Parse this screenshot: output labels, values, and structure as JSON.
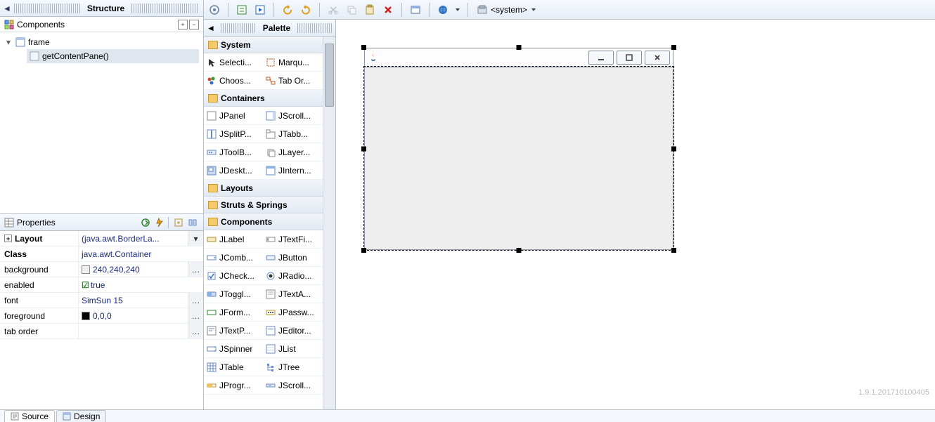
{
  "structure": {
    "header": "Structure",
    "componentsLabel": "Components",
    "tree": {
      "root": {
        "label": "frame"
      },
      "child": {
        "label": "getContentPane()"
      }
    }
  },
  "properties": {
    "header": "Properties",
    "rows": {
      "layout": {
        "name": "Layout",
        "value": "(java.awt.BorderLa..."
      },
      "klass": {
        "name": "Class",
        "value": "java.awt.Container"
      },
      "background": {
        "name": "background",
        "value": "240,240,240",
        "swatch": "#f0f0f0"
      },
      "enabled": {
        "name": "enabled",
        "value": "true"
      },
      "font": {
        "name": "font",
        "value": "SimSun 15"
      },
      "foreground": {
        "name": "foreground",
        "value": "0,0,0",
        "swatch": "#000000"
      },
      "taborder": {
        "name": "tab order",
        "value": ""
      }
    }
  },
  "toolbar": {
    "comboLabel": "<system>"
  },
  "palette": {
    "header": "Palette",
    "categories": {
      "system": "System",
      "containers": "Containers",
      "layouts": "Layouts",
      "struts": "Struts & Springs",
      "components": "Components"
    },
    "system": [
      {
        "a": "Selecti...",
        "b": "Marqu..."
      },
      {
        "a": "Choos...",
        "b": "Tab Or..."
      }
    ],
    "containers": [
      {
        "a": "JPanel",
        "b": "JScroll..."
      },
      {
        "a": "JSplitP...",
        "b": "JTabb..."
      },
      {
        "a": "JToolB...",
        "b": "JLayer..."
      },
      {
        "a": "JDeskt...",
        "b": "JIntern..."
      }
    ],
    "components": [
      {
        "a": "JLabel",
        "b": "JTextFi..."
      },
      {
        "a": "JComb...",
        "b": "JButton"
      },
      {
        "a": "JCheck...",
        "b": "JRadio..."
      },
      {
        "a": "JToggl...",
        "b": "JTextA..."
      },
      {
        "a": "JForm...",
        "b": "JPassw..."
      },
      {
        "a": "JTextP...",
        "b": "JEditor..."
      },
      {
        "a": "JSpinner",
        "b": "JList"
      },
      {
        "a": "JTable",
        "b": "JTree"
      },
      {
        "a": "JProgr...",
        "b": "JScroll..."
      }
    ]
  },
  "bottomTabs": {
    "source": "Source",
    "design": "Design"
  },
  "watermark": "1.9.1.201710100405"
}
